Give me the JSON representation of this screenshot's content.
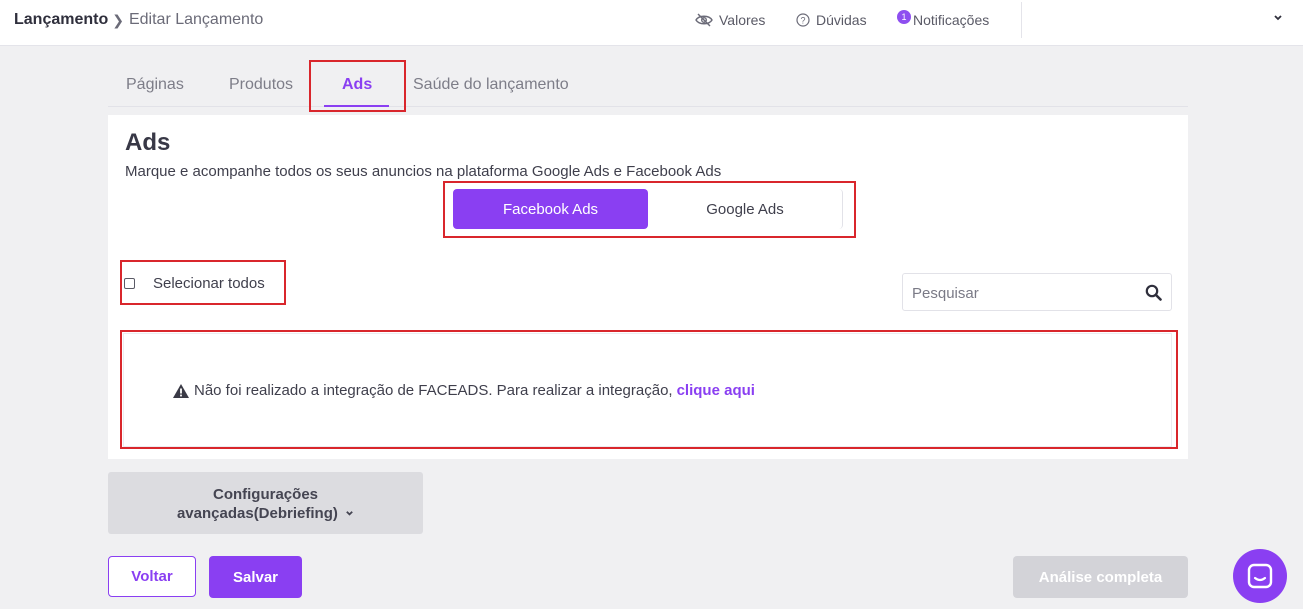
{
  "header": {
    "breadcrumb_root": "Lançamento",
    "breadcrumb_current": "Editar Lançamento",
    "valores_label": "Valores",
    "duvidas_label": "Dúvidas",
    "notificacoes_label": "Notificações",
    "notification_count": "1"
  },
  "tabs": [
    {
      "label": "Páginas"
    },
    {
      "label": "Produtos"
    },
    {
      "label": "Ads"
    },
    {
      "label": "Saúde do lançamento"
    }
  ],
  "panel": {
    "title": "Ads",
    "subtitle": "Marque e acompanhe todos os seus anuncios na plataforma Google Ads e Facebook Ads",
    "toggle": {
      "facebook": "Facebook Ads",
      "google": "Google Ads"
    },
    "select_all_label": "Selecionar todos",
    "search_placeholder": "Pesquisar",
    "alert_text": "Não foi realizado a integração de FACEADS. Para realizar a integração,",
    "alert_link": "clique aqui"
  },
  "advanced": {
    "line1": "Configurações",
    "line2": "avançadas(Debriefing)"
  },
  "buttons": {
    "voltar": "Voltar",
    "salvar": "Salvar",
    "analise": "Análise completa"
  },
  "colors": {
    "accent": "#8a3ff2",
    "highlight": "#d9262c"
  }
}
